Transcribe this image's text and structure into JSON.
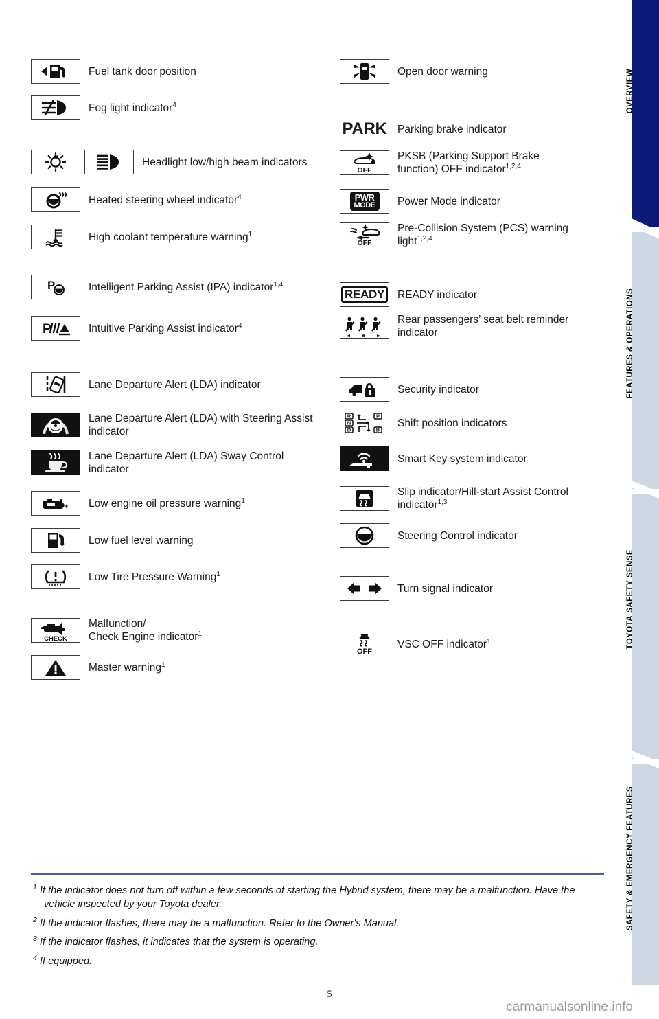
{
  "page": {
    "number": "5",
    "watermark": "carmanualsonline.info"
  },
  "tabs": [
    {
      "label": "OVERVIEW",
      "color": "#0b1a78"
    },
    {
      "label": "FEATURES & OPERATIONS",
      "color": "#ccd7e2"
    },
    {
      "label": "TOYOTA SAFETY SENSE",
      "color": "#ccd7e2"
    },
    {
      "label": "SAFETY & EMERGENCY FEATURES",
      "color": "#ccd7e2"
    }
  ],
  "left_column": [
    {
      "icon": "fuel-tank-door-icon",
      "text": "Fuel tank door position"
    },
    {
      "icon": "fog-light-icon",
      "text": "Fog light indicator",
      "sup": "4"
    },
    {
      "icon": "headlight-low-beam-icon",
      "icon2": "headlight-high-beam-icon",
      "text": "Headlight low/high beam indicators"
    },
    {
      "icon": "heated-steering-wheel-icon",
      "text": "Heated steering wheel indicator",
      "sup": "4"
    },
    {
      "icon": "high-coolant-temperature-icon",
      "text": "High coolant temperature warning",
      "sup": "1"
    },
    {
      "icon": "intelligent-parking-assist-icon",
      "text": "Intelligent Parking Assist (IPA) indicator",
      "sup": "1,4"
    },
    {
      "icon": "intuitive-parking-assist-icon",
      "text": "Intuitive Parking Assist indicator",
      "sup": "4"
    },
    {
      "icon": "lane-departure-alert-icon",
      "text": "Lane Departure Alert (LDA) indicator"
    },
    {
      "icon": "lda-steering-assist-icon",
      "text": "Lane Departure Alert (LDA) with Steering Assist indicator"
    },
    {
      "icon": "lda-sway-control-icon",
      "text": "Lane Departure Alert (LDA) Sway Control indicator"
    },
    {
      "icon": "low-engine-oil-pressure-icon",
      "text": "Low engine oil pressure warning",
      "sup": "1"
    },
    {
      "icon": "low-fuel-level-icon",
      "text": "Low fuel level warning"
    },
    {
      "icon": "low-tire-pressure-icon",
      "text": "Low Tire Pressure Warning",
      "sup": "1"
    },
    {
      "icon": "check-engine-icon",
      "text": "Malfunction/\nCheck Engine indicator",
      "sup": "1"
    },
    {
      "icon": "master-warning-icon",
      "text": "Master warning",
      "sup": "1"
    }
  ],
  "right_column": [
    {
      "icon": "open-door-warning-icon",
      "text": "Open door warning"
    },
    {
      "icon": "parking-brake-icon",
      "text": "Parking brake indicator"
    },
    {
      "icon": "pksb-off-icon",
      "text": "PKSB (Parking Support Brake function) OFF indicator",
      "sup": "1,2,4"
    },
    {
      "icon": "power-mode-icon",
      "text": "Power Mode indicator"
    },
    {
      "icon": "pre-collision-system-off-icon",
      "text": "Pre-Collision System (PCS) warning light",
      "sup": "1,2,4"
    },
    {
      "icon": "ready-indicator-icon",
      "text": "READY indicator"
    },
    {
      "icon": "rear-seat-belt-reminder-icon",
      "text": "Rear passengers’ seat belt reminder indicator"
    },
    {
      "icon": "security-indicator-icon",
      "text": "Security indicator"
    },
    {
      "icon": "shift-position-icon",
      "text": "Shift position indicators"
    },
    {
      "icon": "smart-key-system-icon",
      "text": "Smart Key system indicator"
    },
    {
      "icon": "slip-hill-start-assist-icon",
      "text": "Slip indicator/Hill-start Assist Control indicator",
      "sup": "1,3"
    },
    {
      "icon": "steering-control-icon",
      "text": "Steering Control indicator"
    },
    {
      "icon": "turn-signal-icon",
      "text": "Turn signal indicator"
    },
    {
      "icon": "vsc-off-icon",
      "text": "VSC OFF indicator",
      "sup": "1"
    }
  ],
  "icon_text": {
    "park": "PARK",
    "off": "OFF",
    "pwr": "PWR",
    "mode": "MODE",
    "ready": "READY",
    "check": "CHECK",
    "shift_r": "R",
    "shift_n": "N",
    "shift_d": "D",
    "shift_p": "P",
    "shift_b": "B"
  },
  "footnotes": [
    {
      "marker": "1",
      "text": "If the indicator does not turn off within a few seconds of starting the Hybrid system, there may be a malfunction. Have the vehicle inspected by your Toyota dealer."
    },
    {
      "marker": "2",
      "text": "If the indicator flashes, there may be a malfunction. Refer to the Owner's Manual."
    },
    {
      "marker": "3",
      "text": "If the indicator flashes, it indicates that the system is operating."
    },
    {
      "marker": "4",
      "text": "If equipped."
    }
  ]
}
